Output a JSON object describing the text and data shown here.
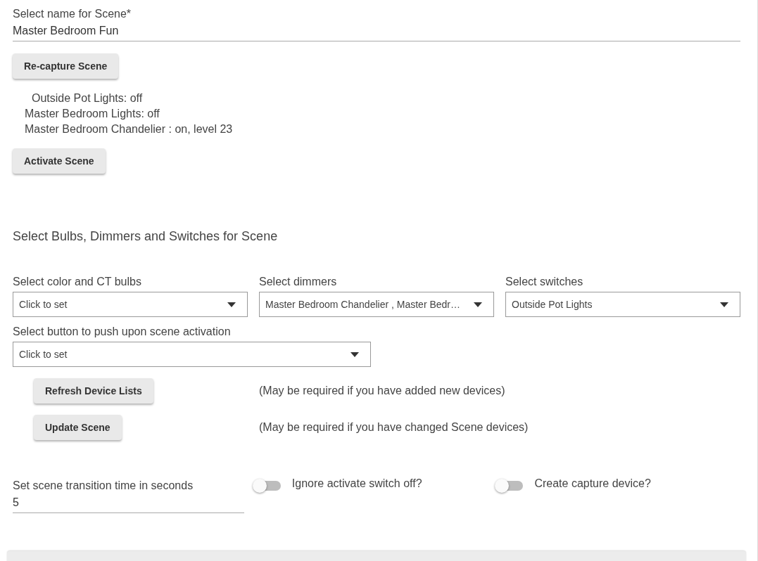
{
  "scene_name": {
    "label": "Select name for Scene*",
    "value": "Master Bedroom Fun"
  },
  "recapture_button": "Re-capture Scene",
  "captured_states": [
    {
      "text": "Outside Pot Lights: off",
      "indented": true
    },
    {
      "text": "Master Bedroom Lights: off",
      "indented": false
    },
    {
      "text": "Master Bedroom Chandelier : on, level 23",
      "indented": false
    }
  ],
  "activate_button": "Activate Scene",
  "section_title": "Select Bulbs, Dimmers and Switches for Scene",
  "device_selects": [
    {
      "label": "Select color and CT bulbs",
      "value": "Click to set"
    },
    {
      "label": "Select dimmers",
      "value": "Master Bedroom Chandelier , Master Bedr…"
    },
    {
      "label": "Select switches",
      "value": "Outside Pot Lights"
    }
  ],
  "button_select": {
    "label": "Select button to push upon scene activation",
    "value": "Click to set"
  },
  "actions": [
    {
      "button": "Refresh Device Lists",
      "note": "(May be required if you have added new devices)"
    },
    {
      "button": "Update Scene",
      "note": "(May be required if you have changed Scene devices)"
    }
  ],
  "transition": {
    "label": "Set scene transition time in seconds",
    "value": "5"
  },
  "toggles": [
    {
      "label": "Ignore activate switch off?",
      "on": false
    },
    {
      "label": "Create capture device?",
      "on": false
    }
  ]
}
